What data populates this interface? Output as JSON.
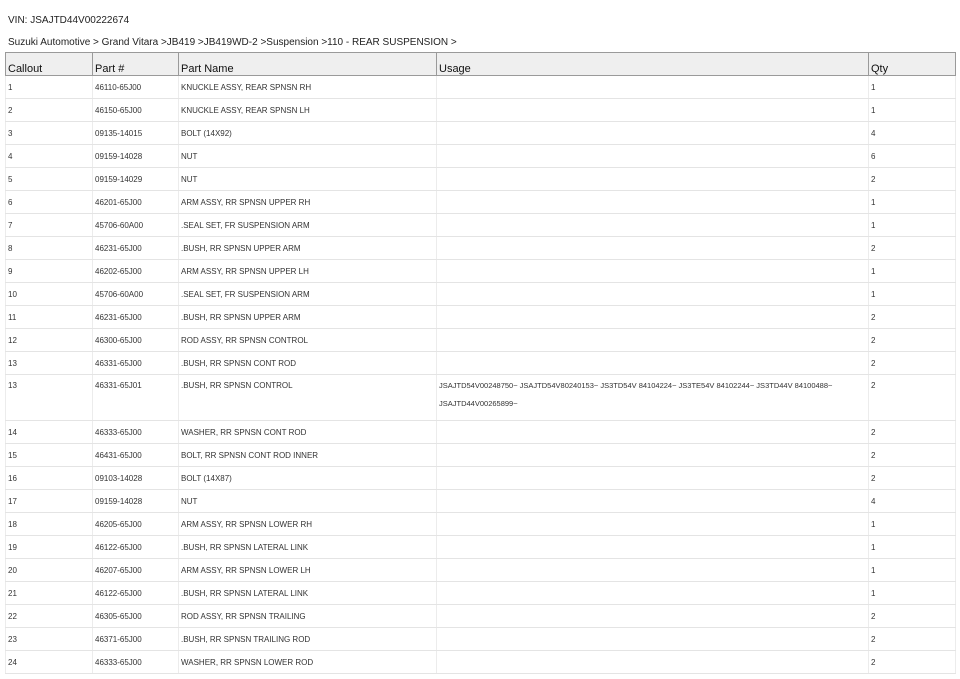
{
  "vin_label": "VIN: JSAJTD44V00222674",
  "breadcrumb": "Suzuki Automotive > Grand Vitara >JB419 >JB419WD-2 >Suspension >110 - REAR SUSPENSION >",
  "table": {
    "headers": [
      "Callout",
      "Part #",
      "Part Name",
      "Usage",
      "Qty"
    ],
    "rows": [
      {
        "callout": "1",
        "part_no": "46110-65J00",
        "name": "KNUCKLE ASSY, REAR SPNSN RH",
        "usage": "",
        "qty": "1"
      },
      {
        "callout": "2",
        "part_no": "46150-65J00",
        "name": "KNUCKLE ASSY, REAR SPNSN LH",
        "usage": "",
        "qty": "1"
      },
      {
        "callout": "3",
        "part_no": "09135-14015",
        "name": "BOLT (14X92)",
        "usage": "",
        "qty": "4"
      },
      {
        "callout": "4",
        "part_no": "09159-14028",
        "name": "NUT",
        "usage": "",
        "qty": "6"
      },
      {
        "callout": "5",
        "part_no": "09159-14029",
        "name": "NUT",
        "usage": "",
        "qty": "2"
      },
      {
        "callout": "6",
        "part_no": "46201-65J00",
        "name": "ARM ASSY, RR SPNSN UPPER RH",
        "usage": "",
        "qty": "1"
      },
      {
        "callout": "7",
        "part_no": "45706-60A00",
        "name": ".SEAL SET, FR SUSPENSION ARM",
        "usage": "",
        "qty": "1"
      },
      {
        "callout": "8",
        "part_no": "46231-65J00",
        "name": ".BUSH, RR SPNSN UPPER ARM",
        "usage": "",
        "qty": "2"
      },
      {
        "callout": "9",
        "part_no": "46202-65J00",
        "name": "ARM ASSY, RR SPNSN UPPER LH",
        "usage": "",
        "qty": "1"
      },
      {
        "callout": "10",
        "part_no": "45706-60A00",
        "name": ".SEAL SET, FR SUSPENSION ARM",
        "usage": "",
        "qty": "1"
      },
      {
        "callout": "11",
        "part_no": "46231-65J00",
        "name": ".BUSH, RR SPNSN UPPER ARM",
        "usage": "",
        "qty": "2"
      },
      {
        "callout": "12",
        "part_no": "46300-65J00",
        "name": "ROD ASSY, RR SPNSN CONTROL",
        "usage": "",
        "qty": "2"
      },
      {
        "callout": "13",
        "part_no": "46331-65J00",
        "name": ".BUSH, RR SPNSN CONT ROD",
        "usage": "",
        "qty": "2"
      },
      {
        "callout": "13",
        "part_no": "46331-65J01",
        "name": ".BUSH, RR SPNSN CONTROL",
        "usage": "JSAJTD54V00248750~ JSAJTD54V80240153~ JS3TD54V 84104224~ JS3TE54V 84102244~ JS3TD44V 84100488~ JSAJTD44V00265899~",
        "qty": "2"
      },
      {
        "callout": "14",
        "part_no": "46333-65J00",
        "name": "WASHER, RR SPNSN CONT ROD",
        "usage": "",
        "qty": "2"
      },
      {
        "callout": "15",
        "part_no": "46431-65J00",
        "name": "BOLT, RR SPNSN CONT ROD INNER",
        "usage": "",
        "qty": "2"
      },
      {
        "callout": "16",
        "part_no": "09103-14028",
        "name": "BOLT (14X87)",
        "usage": "",
        "qty": "2"
      },
      {
        "callout": "17",
        "part_no": "09159-14028",
        "name": "NUT",
        "usage": "",
        "qty": "4"
      },
      {
        "callout": "18",
        "part_no": "46205-65J00",
        "name": "ARM ASSY, RR SPNSN LOWER RH",
        "usage": "",
        "qty": "1"
      },
      {
        "callout": "19",
        "part_no": "46122-65J00",
        "name": ".BUSH, RR SPNSN LATERAL LINK",
        "usage": "",
        "qty": "1"
      },
      {
        "callout": "20",
        "part_no": "46207-65J00",
        "name": "ARM ASSY, RR SPNSN LOWER LH",
        "usage": "",
        "qty": "1"
      },
      {
        "callout": "21",
        "part_no": "46122-65J00",
        "name": ".BUSH, RR SPNSN LATERAL LINK",
        "usage": "",
        "qty": "1"
      },
      {
        "callout": "22",
        "part_no": "46305-65J00",
        "name": "ROD ASSY, RR SPNSN TRAILING",
        "usage": "",
        "qty": "2"
      },
      {
        "callout": "23",
        "part_no": "46371-65J00",
        "name": ".BUSH, RR SPNSN TRAILING ROD",
        "usage": "",
        "qty": "2"
      },
      {
        "callout": "24",
        "part_no": "46333-65J00",
        "name": "WASHER, RR SPNSN LOWER ROD",
        "usage": "",
        "qty": "2"
      }
    ]
  }
}
